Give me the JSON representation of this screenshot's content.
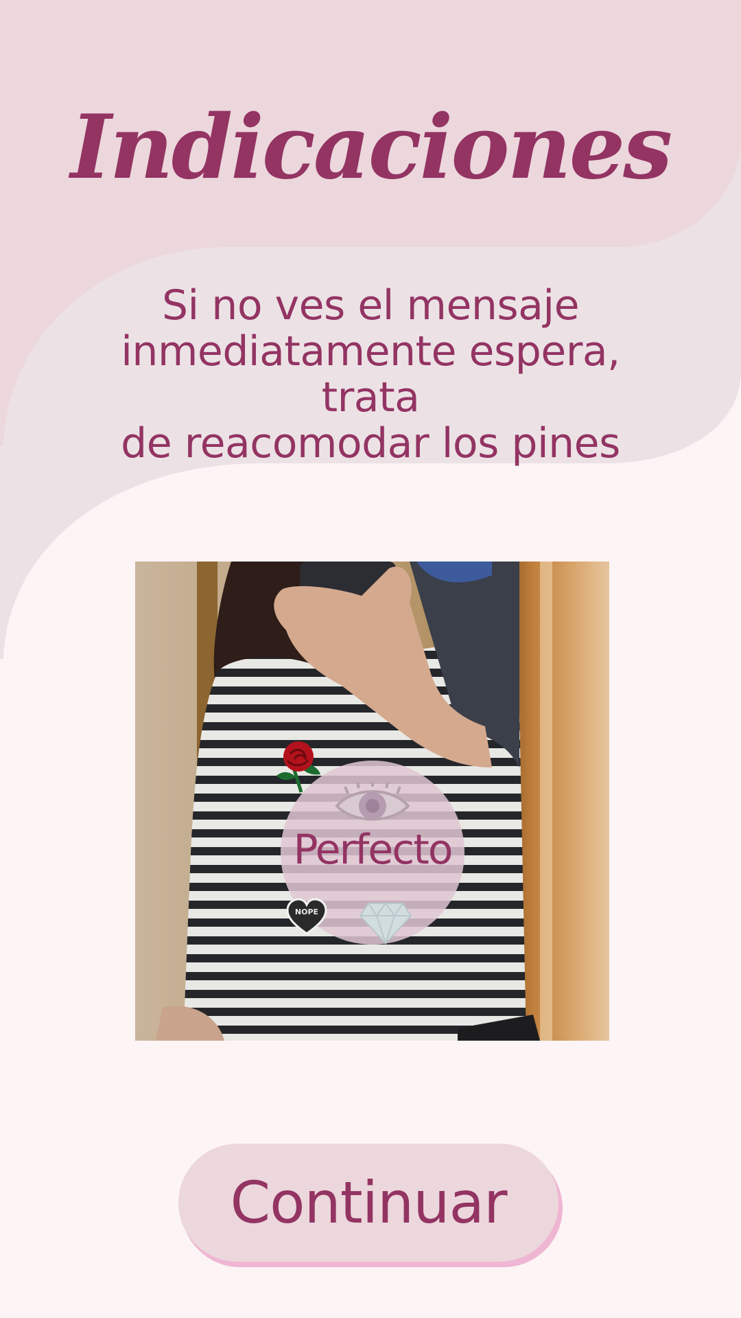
{
  "theme": {
    "accent": "#933463",
    "background": "#fdf4f5",
    "top_wave": "#ecd7dc",
    "mid_wave": "#ece2e5",
    "button_fill": "#ecd7dc",
    "button_shadow": "#efb6d3"
  },
  "header": {
    "title": "Indicaciones"
  },
  "instructions": {
    "lines": [
      "Si no ves el mensaje",
      "inmediatamente espera, trata",
      "de reacomodar los pines"
    ]
  },
  "preview": {
    "overlay_label": "Perfecto",
    "pins": [
      "rose-pin",
      "eye-pin",
      "heart-pin",
      "diamond-pin"
    ],
    "heart_pin_text": "NOPE"
  },
  "actions": {
    "continue_label": "Continuar"
  }
}
